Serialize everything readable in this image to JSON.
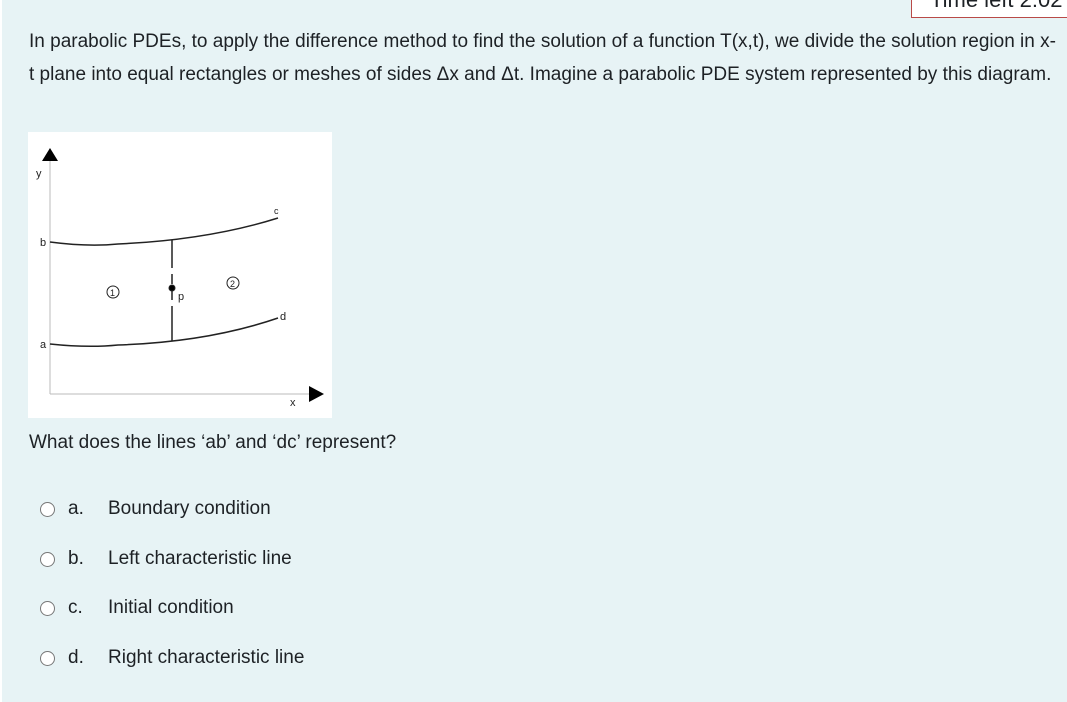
{
  "timer": {
    "label": "Time left 2:02"
  },
  "question": {
    "text": "In parabolic PDEs, to apply the difference method to find the solution of a function T(x,t), we divide the solution region in x-t plane into equal rectangles or meshes of sides Δx and Δt. Imagine a parabolic PDE system represented by this diagram.",
    "diagram_labels": {
      "y": "y",
      "x": "x",
      "a": "a",
      "b": "b",
      "c": "c",
      "d": "d",
      "p": "p",
      "region1": "1",
      "region2": "2"
    },
    "prompt": "What does the lines ‘ab’ and ‘dc’ represent?"
  },
  "options": [
    {
      "letter": "a.",
      "label": "Boundary condition"
    },
    {
      "letter": "b.",
      "label": "Left characteristic line"
    },
    {
      "letter": "c.",
      "label": "Initial condition"
    },
    {
      "letter": "d.",
      "label": "Right characteristic line"
    }
  ]
}
